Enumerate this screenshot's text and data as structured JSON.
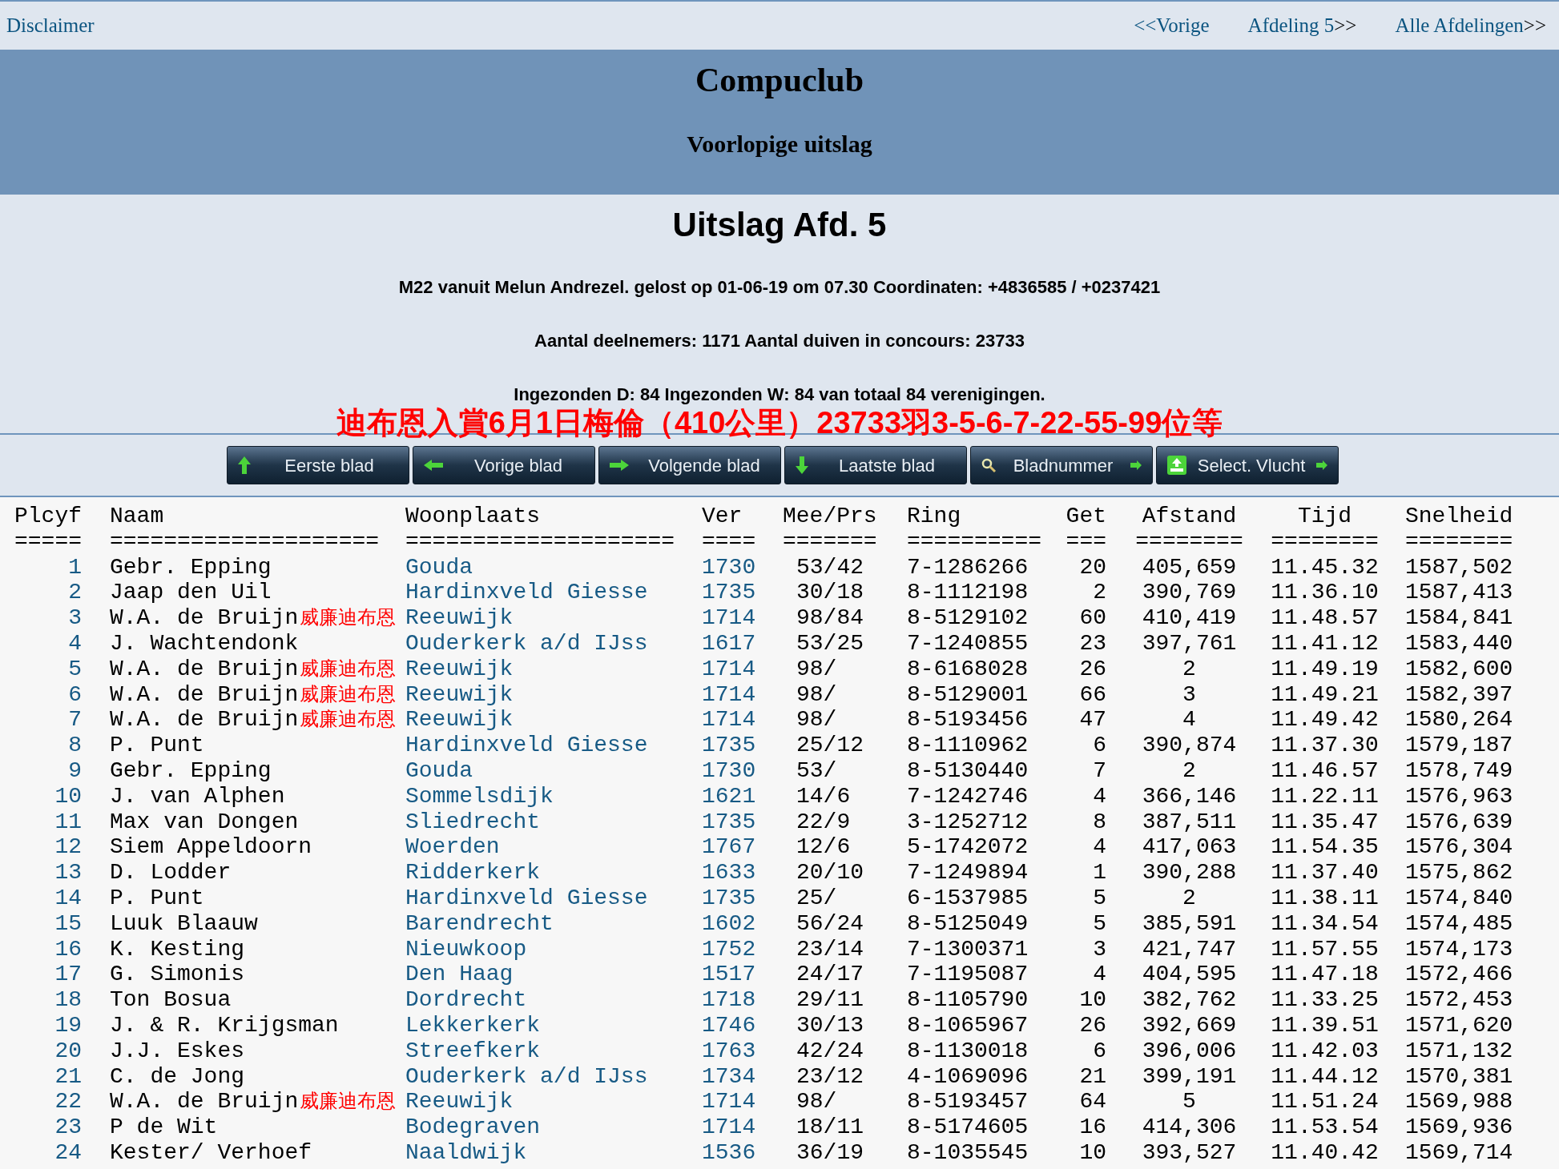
{
  "topbar": {
    "left_link": "Disclaimer",
    "links": [
      {
        "label": "<<Vorige"
      },
      {
        "label": "Afdeling 5",
        "suffix": ">>"
      },
      {
        "label": "Alle Afdelingen",
        "suffix": ">>"
      }
    ]
  },
  "banner": {
    "title": "Compuclub",
    "subtitle": "Voorlopige uitslag"
  },
  "info": {
    "heading": "Uitslag Afd. 5",
    "lines": [
      "M22 vanuit Melun Andrezel. gelost op 01-06-19 om 07.30 Coordinaten: +4836585 / +0237421",
      "Aantal deelnemers: 1171 Aantal duiven in concours: 23733",
      "Ingezonden D: 84 Ingezonden W: 84 van totaal 84 verenigingen."
    ],
    "highlight": "迪布恩入賞6月1日梅倫（410公里）23733羽3-5-6-7-22-55-99位等"
  },
  "toolbar": [
    {
      "label": "Eerste blad",
      "kind": "first"
    },
    {
      "label": "Vorige blad",
      "kind": "previous"
    },
    {
      "label": "Volgende blad",
      "kind": "next"
    },
    {
      "label": "Laatste blad",
      "kind": "last"
    },
    {
      "label": "Bladnummer",
      "kind": "pagenumber"
    },
    {
      "label": "Select. Vlucht",
      "kind": "selectflight"
    }
  ],
  "table": {
    "columns": [
      {
        "label": "Plcyf",
        "rule": "====="
      },
      {
        "label": "Naam",
        "rule": "===================="
      },
      {
        "label": "Woonplaats",
        "rule": "===================="
      },
      {
        "label": "Ver",
        "rule": "===="
      },
      {
        "label": "Mee/Prs",
        "rule": "======="
      },
      {
        "label": "Ring",
        "rule": "=========="
      },
      {
        "label": "Get",
        "rule": "==="
      },
      {
        "label": "Afstand",
        "rule": "========"
      },
      {
        "label": "Tijd",
        "rule": "========"
      },
      {
        "label": "Snelheid",
        "rule": "========"
      }
    ],
    "rows": [
      {
        "plcyf": "1",
        "naam": "Gebr. Epping",
        "woonplaats": "Gouda",
        "ver": "1730",
        "mee": "53/42",
        "ring": "7-1286266",
        "get": "20",
        "afstand": "405,659",
        "tijd": "11.45.32",
        "snelheid": "1587,502"
      },
      {
        "plcyf": "2",
        "naam": "Jaap den Uil",
        "woonplaats": "Hardinxveld Giesse",
        "ver": "1735",
        "mee": "30/18",
        "ring": "8-1112198",
        "get": "2",
        "afstand": "390,769",
        "tijd": "11.36.10",
        "snelheid": "1587,413"
      },
      {
        "plcyf": "3",
        "naam": "W.A. de Bruijn",
        "note": "威廉迪布恩",
        "woonplaats": "Reeuwijk",
        "ver": "1714",
        "mee": "98/84",
        "ring": "8-5129102",
        "get": "60",
        "afstand": "410,419",
        "tijd": "11.48.57",
        "snelheid": "1584,841"
      },
      {
        "plcyf": "4",
        "naam": "J. Wachtendonk",
        "woonplaats": "Ouderkerk a/d IJss",
        "ver": "1617",
        "mee": "53/25",
        "ring": "7-1240855",
        "get": "23",
        "afstand": "397,761",
        "tijd": "11.41.12",
        "snelheid": "1583,440"
      },
      {
        "plcyf": "5",
        "naam": "W.A. de Bruijn",
        "note": "威廉迪布恩",
        "woonplaats": "Reeuwijk",
        "ver": "1714",
        "mee": "98/",
        "ring": "8-6168028",
        "get": "26",
        "afstand": "2",
        "tijd": "11.49.19",
        "snelheid": "1582,600"
      },
      {
        "plcyf": "6",
        "naam": "W.A. de Bruijn",
        "note": "威廉迪布恩",
        "woonplaats": "Reeuwijk",
        "ver": "1714",
        "mee": "98/",
        "ring": "8-5129001",
        "get": "66",
        "afstand": "3",
        "tijd": "11.49.21",
        "snelheid": "1582,397"
      },
      {
        "plcyf": "7",
        "naam": "W.A. de Bruijn",
        "note": "威廉迪布恩",
        "woonplaats": "Reeuwijk",
        "ver": "1714",
        "mee": "98/",
        "ring": "8-5193456",
        "get": "47",
        "afstand": "4",
        "tijd": "11.49.42",
        "snelheid": "1580,264"
      },
      {
        "plcyf": "8",
        "naam": "P. Punt",
        "woonplaats": "Hardinxveld Giesse",
        "ver": "1735",
        "mee": "25/12",
        "ring": "8-1110962",
        "get": "6",
        "afstand": "390,874",
        "tijd": "11.37.30",
        "snelheid": "1579,187"
      },
      {
        "plcyf": "9",
        "naam": "Gebr. Epping",
        "woonplaats": "Gouda",
        "ver": "1730",
        "mee": "53/",
        "ring": "8-5130440",
        "get": "7",
        "afstand": "2",
        "tijd": "11.46.57",
        "snelheid": "1578,749"
      },
      {
        "plcyf": "10",
        "naam": "J. van Alphen",
        "woonplaats": "Sommelsdijk",
        "ver": "1621",
        "mee": "14/6",
        "ring": "7-1242746",
        "get": "4",
        "afstand": "366,146",
        "tijd": "11.22.11",
        "snelheid": "1576,963"
      },
      {
        "plcyf": "11",
        "naam": "Max van Dongen",
        "woonplaats": "Sliedrecht",
        "ver": "1735",
        "mee": "22/9",
        "ring": "3-1252712",
        "get": "8",
        "afstand": "387,511",
        "tijd": "11.35.47",
        "snelheid": "1576,639"
      },
      {
        "plcyf": "12",
        "naam": "Siem Appeldoorn",
        "woonplaats": "Woerden",
        "ver": "1767",
        "mee": "12/6",
        "ring": "5-1742072",
        "get": "4",
        "afstand": "417,063",
        "tijd": "11.54.35",
        "snelheid": "1576,304"
      },
      {
        "plcyf": "13",
        "naam": "D. Lodder",
        "woonplaats": "Ridderkerk",
        "ver": "1633",
        "mee": "20/10",
        "ring": "7-1249894",
        "get": "1",
        "afstand": "390,288",
        "tijd": "11.37.40",
        "snelheid": "1575,862"
      },
      {
        "plcyf": "14",
        "naam": "P. Punt",
        "woonplaats": "Hardinxveld Giesse",
        "ver": "1735",
        "mee": "25/",
        "ring": "6-1537985",
        "get": "5",
        "afstand": "2",
        "tijd": "11.38.11",
        "snelheid": "1574,840"
      },
      {
        "plcyf": "15",
        "naam": "Luuk Blaauw",
        "woonplaats": "Barendrecht",
        "ver": "1602",
        "mee": "56/24",
        "ring": "8-5125049",
        "get": "5",
        "afstand": "385,591",
        "tijd": "11.34.54",
        "snelheid": "1574,485"
      },
      {
        "plcyf": "16",
        "naam": "K. Kesting",
        "woonplaats": "Nieuwkoop",
        "ver": "1752",
        "mee": "23/14",
        "ring": "7-1300371",
        "get": "3",
        "afstand": "421,747",
        "tijd": "11.57.55",
        "snelheid": "1574,173"
      },
      {
        "plcyf": "17",
        "naam": "G. Simonis",
        "woonplaats": "Den Haag",
        "ver": "1517",
        "mee": "24/17",
        "ring": "7-1195087",
        "get": "4",
        "afstand": "404,595",
        "tijd": "11.47.18",
        "snelheid": "1572,466"
      },
      {
        "plcyf": "18",
        "naam": "Ton Bosua",
        "woonplaats": "Dordrecht",
        "ver": "1718",
        "mee": "29/11",
        "ring": "8-1105790",
        "get": "10",
        "afstand": "382,762",
        "tijd": "11.33.25",
        "snelheid": "1572,453"
      },
      {
        "plcyf": "19",
        "naam": "J. & R. Krijgsman",
        "woonplaats": "Lekkerkerk",
        "ver": "1746",
        "mee": "30/13",
        "ring": "8-1065967",
        "get": "26",
        "afstand": "392,669",
        "tijd": "11.39.51",
        "snelheid": "1571,620"
      },
      {
        "plcyf": "20",
        "naam": "J.J. Eskes",
        "woonplaats": "Streefkerk",
        "ver": "1763",
        "mee": "42/24",
        "ring": "8-1130018",
        "get": "6",
        "afstand": "396,006",
        "tijd": "11.42.03",
        "snelheid": "1571,132"
      },
      {
        "plcyf": "21",
        "naam": "C. de Jong",
        "woonplaats": "Ouderkerk a/d IJss",
        "ver": "1734",
        "mee": "23/12",
        "ring": "4-1069096",
        "get": "21",
        "afstand": "399,191",
        "tijd": "11.44.12",
        "snelheid": "1570,381"
      },
      {
        "plcyf": "22",
        "naam": "W.A. de Bruijn",
        "note": "威廉迪布恩",
        "woonplaats": "Reeuwijk",
        "ver": "1714",
        "mee": "98/",
        "ring": "8-5193457",
        "get": "64",
        "afstand": "5",
        "tijd": "11.51.24",
        "snelheid": "1569,988"
      },
      {
        "plcyf": "23",
        "naam": "P de Wit",
        "woonplaats": "Bodegraven",
        "ver": "1714",
        "mee": "18/11",
        "ring": "8-5174605",
        "get": "16",
        "afstand": "414,306",
        "tijd": "11.53.54",
        "snelheid": "1569,936"
      },
      {
        "plcyf": "24",
        "naam": "Kester/ Verhoef",
        "woonplaats": "Naaldwijk",
        "ver": "1536",
        "mee": "36/19",
        "ring": "8-1035545",
        "get": "10",
        "afstand": "393,527",
        "tijd": "11.40.42",
        "snelheid": "1569,714"
      }
    ]
  }
}
